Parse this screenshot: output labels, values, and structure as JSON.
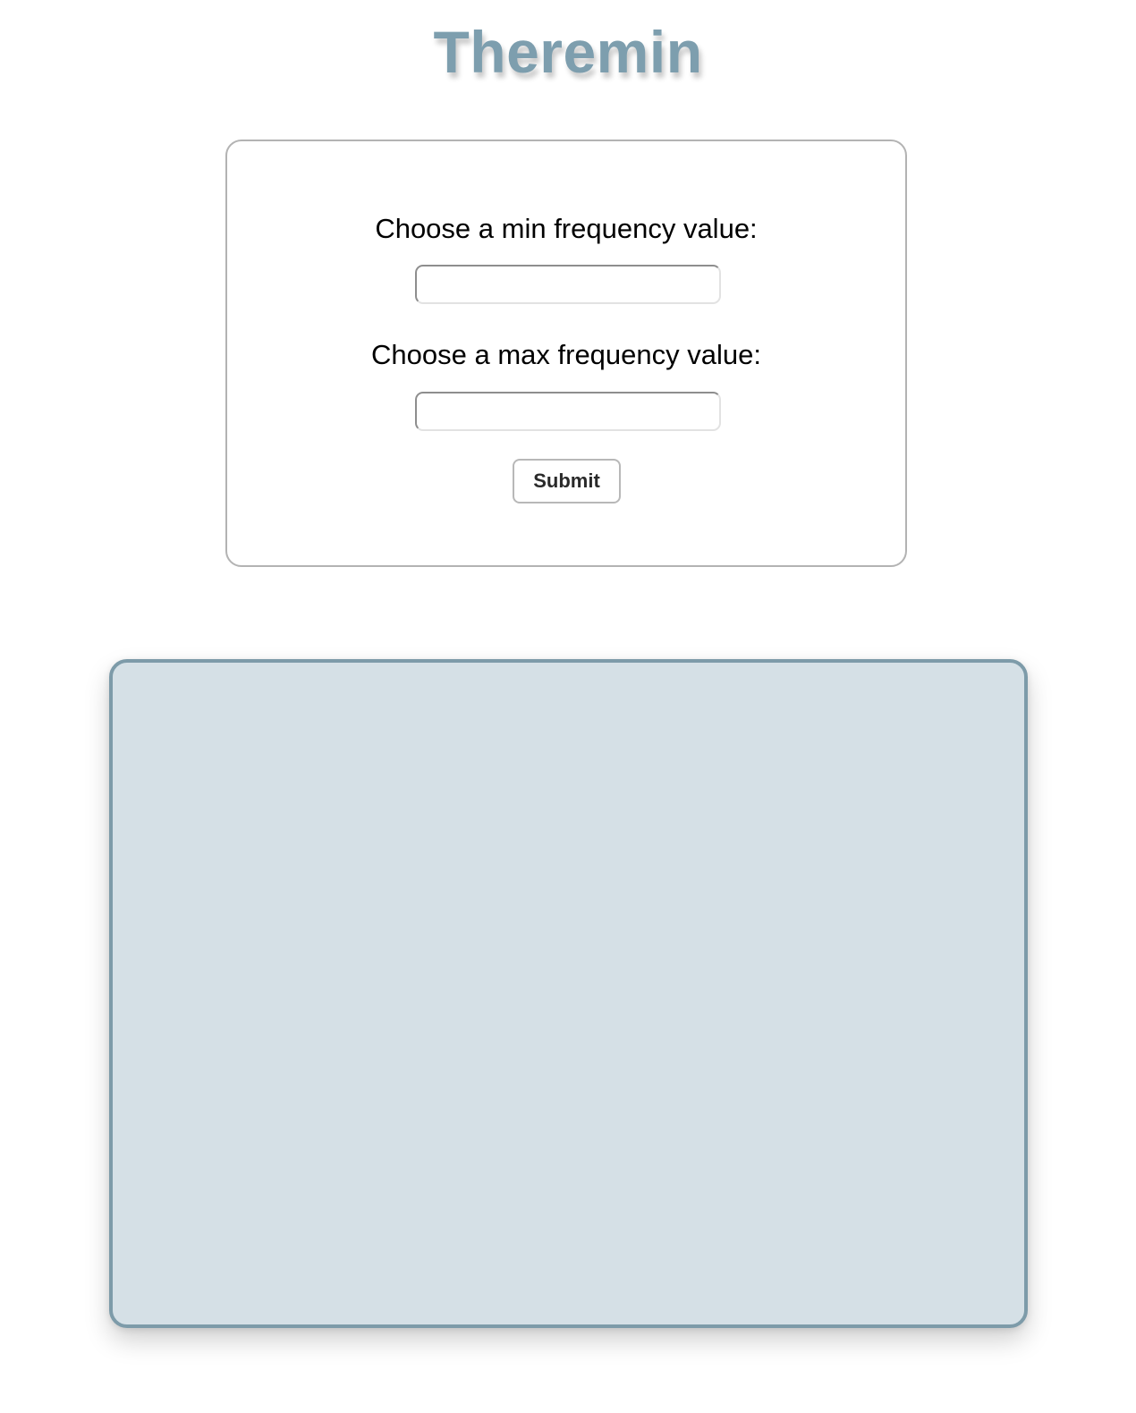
{
  "header": {
    "title": "Theremin"
  },
  "form": {
    "min_label": "Choose a min frequency value:",
    "min_value": "",
    "max_label": "Choose a max frequency value:",
    "max_value": "",
    "submit_label": "Submit"
  },
  "colors": {
    "accent": "#7d9eae",
    "play_area_fill": "#d5e0e6",
    "play_area_border": "#7d9ba9",
    "card_border": "#b3b3b3"
  }
}
